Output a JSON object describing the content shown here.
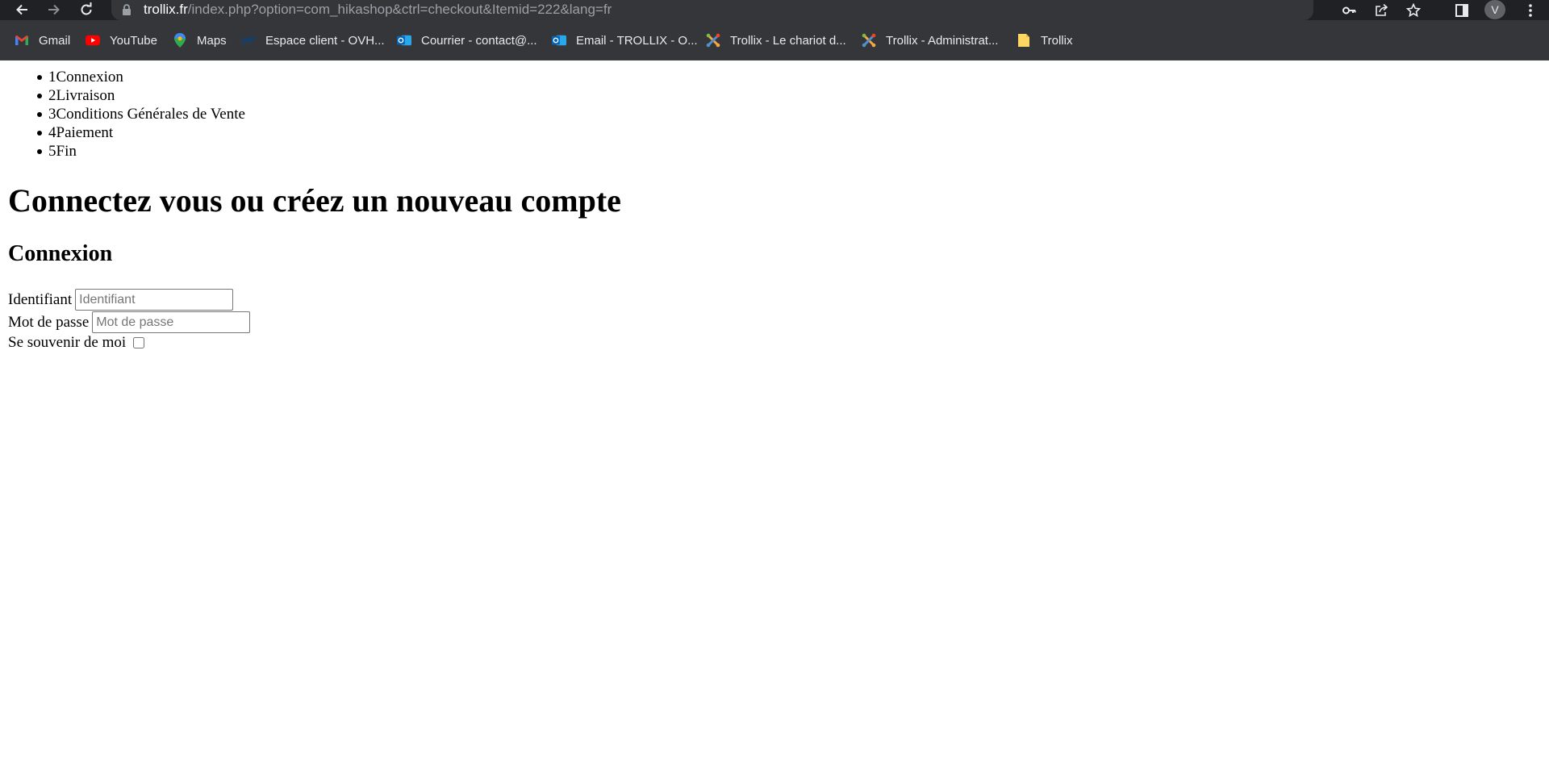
{
  "browser": {
    "url_domain": "trollix.fr",
    "url_path": "/index.php?option=com_hikashop&ctrl=checkout&Itemid=222&lang=fr",
    "profile_initial": "V",
    "bookmarks": [
      {
        "label": "Gmail",
        "icon": "gmail-icon"
      },
      {
        "label": "YouTube",
        "icon": "youtube-icon"
      },
      {
        "label": "Maps",
        "icon": "maps-icon"
      },
      {
        "label": "Espace client - OVH...",
        "icon": "ovh-icon"
      },
      {
        "label": "Courrier - contact@...",
        "icon": "outlook-icon"
      },
      {
        "label": "Email - TROLLIX - O...",
        "icon": "outlook-icon"
      },
      {
        "label": "Trollix - Le chariot d...",
        "icon": "joomla-icon"
      },
      {
        "label": "Trollix - Administrat...",
        "icon": "joomla-icon"
      },
      {
        "label": "Trollix",
        "icon": "folder-icon"
      }
    ]
  },
  "checkout": {
    "steps": [
      {
        "number": "1",
        "label": "Connexion"
      },
      {
        "number": "2",
        "label": "Livraison"
      },
      {
        "number": "3",
        "label": "Conditions Générales de Vente"
      },
      {
        "number": "4",
        "label": "Paiement"
      },
      {
        "number": "5",
        "label": "Fin"
      }
    ],
    "title": "Connectez vous ou créez un nouveau compte",
    "login": {
      "heading": "Connexion",
      "username_label": "Identifiant",
      "username_placeholder": "Identifiant",
      "password_label": "Mot de passe",
      "password_placeholder": "Mot de passe",
      "remember_label": "Se souvenir de moi"
    }
  }
}
